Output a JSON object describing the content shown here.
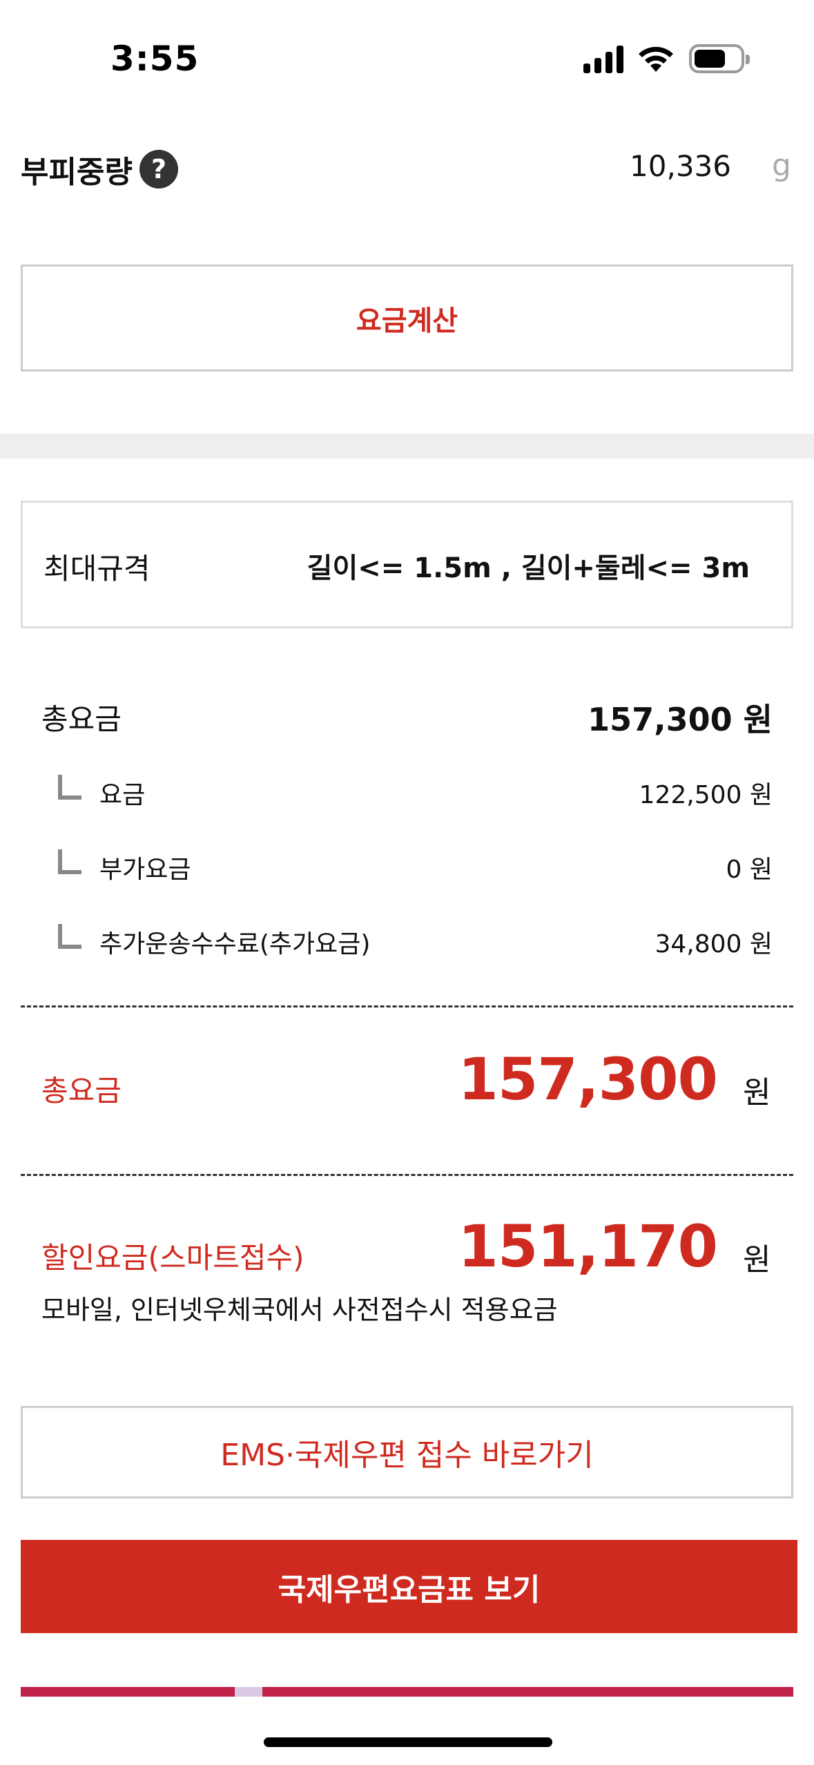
{
  "status_bar": {
    "time": "3:55"
  },
  "volumetric_weight": {
    "label": "부피중량",
    "help_symbol": "?",
    "value": "10,336",
    "unit": "g"
  },
  "calc_button": {
    "label": "요금계산"
  },
  "max_size": {
    "label": "최대규격",
    "value": "길이<= 1.5m , 길이+둘레<= 3m"
  },
  "fee_breakdown": {
    "total_label": "총요금",
    "total_value": "157,300 원",
    "items": [
      {
        "label": "요금",
        "value": "122,500 원"
      },
      {
        "label": "부가요금",
        "value": "0 원"
      },
      {
        "label": "추가운송수수료(추가요금)",
        "value": "34,800 원"
      }
    ]
  },
  "total": {
    "label": "총요금",
    "amount": "157,300",
    "unit": "원"
  },
  "discount": {
    "label": "할인요금(스마트접수)",
    "amount": "151,170",
    "unit": "원",
    "note": "모바일, 인터넷우체국에서 사전접수시 적용요금"
  },
  "ems_button": {
    "label": "EMS·국제우편 접수 바로가기"
  },
  "rate_table_button": {
    "label": "국제우편요금표 보기"
  },
  "colors": {
    "accent_red": "#cf2a1f",
    "banner": "#c0224a"
  }
}
